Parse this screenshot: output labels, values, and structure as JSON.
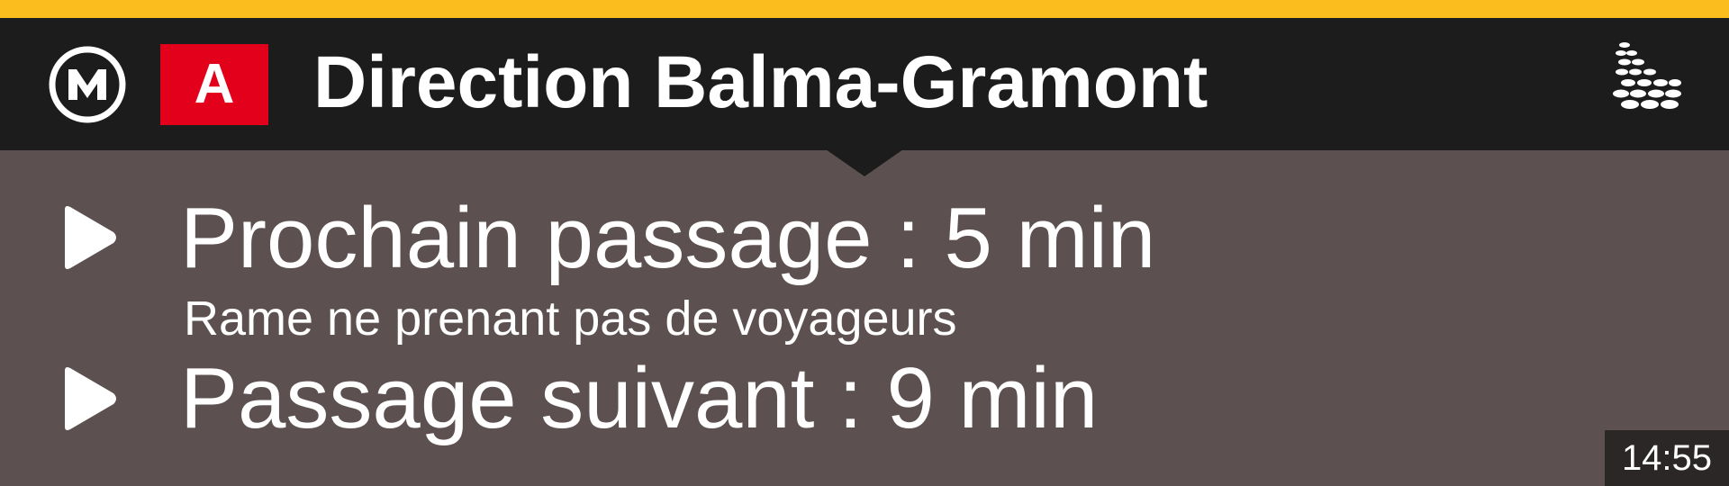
{
  "header": {
    "mode_icon": "metro-m-icon",
    "line": "A",
    "direction": "Direction Balma-Gramont",
    "operator_icon": "operator-logo-icon",
    "accent_color": "#fbbd1e",
    "line_color": "#e2001a",
    "header_color": "#1c1c1c"
  },
  "departures": [
    {
      "icon": "play-arrow-icon",
      "text": "Prochain passage : 5 min",
      "note": "Rame ne prenant pas de voyageurs"
    },
    {
      "icon": "play-arrow-icon",
      "text": "Passage suivant : 9 min"
    }
  ],
  "clock": "14:55",
  "background_color": "#5c5150"
}
